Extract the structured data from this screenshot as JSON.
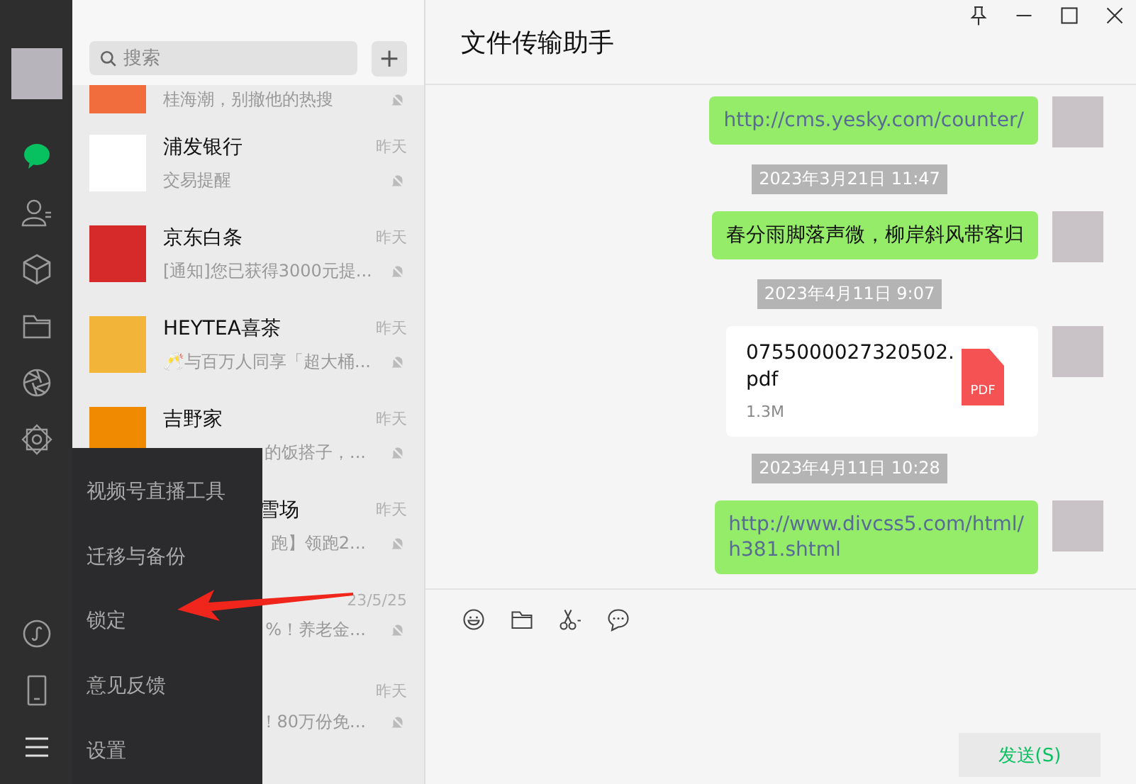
{
  "nav_items": [
    {
      "selected": true
    },
    {
      "selected": false
    },
    {
      "selected": false
    },
    {
      "selected": false
    },
    {
      "selected": false
    },
    {
      "selected": false
    }
  ],
  "nav_bottom": [
    {
      "selected": false
    },
    {
      "selected": false
    },
    {
      "selected": true
    }
  ],
  "search": {
    "placeholder": "搜索",
    "add_label": "+"
  },
  "chats": [
    {
      "kind": "cut",
      "preview": "桂海潮，别撤他的热搜",
      "muted": true
    },
    {
      "kind": "open",
      "name": "浦发银行",
      "time": "昨天",
      "preview": "交易提醒",
      "muted": true
    },
    {
      "kind": "open",
      "name": "京东白条",
      "time": "昨天",
      "preview": "[通知]您已获得3000元提...",
      "muted": true
    },
    {
      "kind": "open",
      "name": "HEYTEA喜茶",
      "time": "昨天",
      "preview": "🥂与百万人同享「超大桶...",
      "muted": true
    },
    {
      "kind": "half",
      "name": "吉野家",
      "time": "昨天",
      "preview": "的饭搭子，...",
      "muted": true
    },
    {
      "kind": "covered",
      "name": "雪场",
      "time": "昨天",
      "preview": "跑】领跑2...",
      "muted": true
    },
    {
      "kind": "covered",
      "time": "23/5/25",
      "preview": "%！养老金...",
      "muted": true
    },
    {
      "kind": "covered",
      "time": "昨天",
      "preview": "！80万份免...",
      "muted": true
    }
  ],
  "menu": [
    {
      "label": "视频号直播工具"
    },
    {
      "label": "迁移与备份"
    },
    {
      "label": "锁定"
    },
    {
      "label": "意见反馈"
    },
    {
      "label": "设置"
    }
  ],
  "chat": {
    "title": "文件传输助手",
    "messages": [
      {
        "kind": "link",
        "text": "http://cms.yesky.com/counter/"
      },
      {
        "kind": "time",
        "text": "2023年3月21日 11:47"
      },
      {
        "kind": "text",
        "text": "春分雨脚落声微，柳岸斜风带客归"
      },
      {
        "kind": "time",
        "text": "2023年4月11日 9:07"
      },
      {
        "kind": "file",
        "text": "0755000027320502.\npdf",
        "size": "1.3M",
        "file_type": "PDF"
      },
      {
        "kind": "time",
        "text": "2023年4月11日 10:28"
      },
      {
        "kind": "link",
        "text": "http://www.divcss5.com/html/\nh381.shtml"
      }
    ],
    "send_label": "发送(S)"
  }
}
